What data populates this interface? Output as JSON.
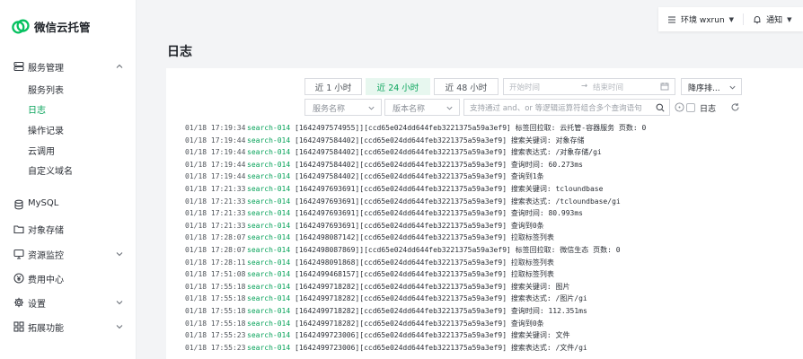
{
  "brand": {
    "name": "微信云托管"
  },
  "sidebar": {
    "groups": [
      {
        "label": "服务管理",
        "icon": "server-icon",
        "expanded": true
      },
      {
        "label": "MySQL",
        "icon": "database-icon"
      },
      {
        "label": "对象存储",
        "icon": "folder-icon"
      },
      {
        "label": "资源监控",
        "icon": "monitor-icon",
        "expandable": true
      },
      {
        "label": "费用中心",
        "icon": "yen-icon"
      },
      {
        "label": "设置",
        "icon": "gear-icon",
        "expandable": true
      },
      {
        "label": "拓展功能",
        "icon": "grid-icon",
        "expandable": true
      }
    ],
    "sub_items": [
      {
        "label": "服务列表"
      },
      {
        "label": "日志",
        "active": true
      },
      {
        "label": "操作记录"
      },
      {
        "label": "云调用"
      },
      {
        "label": "自定义域名"
      }
    ]
  },
  "topbar": {
    "env_label": "环境 wxrun",
    "notify_label": "通知"
  },
  "page": {
    "title": "日志"
  },
  "filters": {
    "ranges": [
      {
        "label": "近 1 小时"
      },
      {
        "label": "近 24 小时",
        "active": true
      },
      {
        "label": "近 48 小时"
      }
    ],
    "start_placeholder": "开始时间",
    "arrow": "→",
    "end_placeholder": "结束时间",
    "sort_label": "降序排...",
    "service_placeholder": "服务名称",
    "version_placeholder": "版本名称",
    "query_placeholder": "支持通过 and、or 等逻辑运算符组合多个查询语句",
    "context_label": "日志"
  },
  "colors": {
    "accent": "#07a35a",
    "accent_bg": "#e7f7ef"
  },
  "logs": [
    {
      "time": "01/18 17:19:34",
      "source": "search-014",
      "message": "[1642497574955]][ccd65e024dd644feb3221375a59a3ef9] 标签回拉取: 云托管-容器服务 页数: 0"
    },
    {
      "time": "01/18 17:19:44",
      "source": "search-014",
      "message": "[1642497584402][ccd65e024dd644feb3221375a59a3ef9] 搜索关键词: 对象存储"
    },
    {
      "time": "01/18 17:19:44",
      "source": "search-014",
      "message": "[1642497584402][ccd65e024dd644feb3221375a59a3ef9] 搜索表达式: /对象存储/gi"
    },
    {
      "time": "01/18 17:19:44",
      "source": "search-014",
      "message": "[1642497584402][ccd65e024dd644feb3221375a59a3ef9] 查询时间: 60.273ms"
    },
    {
      "time": "01/18 17:19:44",
      "source": "search-014",
      "message": "[1642497584402][ccd65e024dd644feb3221375a59a3ef9] 查询到1条"
    },
    {
      "time": "01/18 17:21:33",
      "source": "search-014",
      "message": "[1642497693691][ccd65e024dd644feb3221375a59a3ef9] 搜索关键词: tcloundbase"
    },
    {
      "time": "01/18 17:21:33",
      "source": "search-014",
      "message": "[1642497693691][ccd65e024dd644feb3221375a59a3ef9] 搜索表达式: /tcloundbase/gi"
    },
    {
      "time": "01/18 17:21:33",
      "source": "search-014",
      "message": "[1642497693691][ccd65e024dd644feb3221375a59a3ef9] 查询时间: 80.993ms"
    },
    {
      "time": "01/18 17:21:33",
      "source": "search-014",
      "message": "[1642497693691][ccd65e024dd644feb3221375a59a3ef9] 查询到0条"
    },
    {
      "time": "01/18 17:28:07",
      "source": "search-014",
      "message": "[1642498087142][ccd65e024dd644feb3221375a59a3ef9] 拉取标签列表"
    },
    {
      "time": "01/18 17:28:07",
      "source": "search-014",
      "message": "[1642498087869]][ccd65e024dd644feb3221375a59a3ef9] 标签回拉取: 微信生态 页数: 0"
    },
    {
      "time": "01/18 17:28:11",
      "source": "search-014",
      "message": "[1642498091868][ccd65e024dd644feb3221375a59a3ef9] 拉取标签列表"
    },
    {
      "time": "01/18 17:51:08",
      "source": "search-014",
      "message": "[1642499468157][ccd65e024dd644feb3221375a59a3ef9] 拉取标签列表"
    },
    {
      "time": "01/18 17:55:18",
      "source": "search-014",
      "message": "[1642499718282][ccd65e024dd644feb3221375a59a3ef9] 搜索关键词: 图片"
    },
    {
      "time": "01/18 17:55:18",
      "source": "search-014",
      "message": "[1642499718282][ccd65e024dd644feb3221375a59a3ef9] 搜索表达式: /图片/gi"
    },
    {
      "time": "01/18 17:55:18",
      "source": "search-014",
      "message": "[1642499718282][ccd65e024dd644feb3221375a59a3ef9] 查询时间: 112.351ms"
    },
    {
      "time": "01/18 17:55:18",
      "source": "search-014",
      "message": "[1642499718282][ccd65e024dd644feb3221375a59a3ef9] 查询到0条"
    },
    {
      "time": "01/18 17:55:23",
      "source": "search-014",
      "message": "[1642499723006][ccd65e024dd644feb3221375a59a3ef9] 搜索关键词: 文件"
    },
    {
      "time": "01/18 17:55:23",
      "source": "search-014",
      "message": "[1642499723006][ccd65e024dd644feb3221375a59a3ef9] 搜索表达式: /文件/gi"
    }
  ]
}
